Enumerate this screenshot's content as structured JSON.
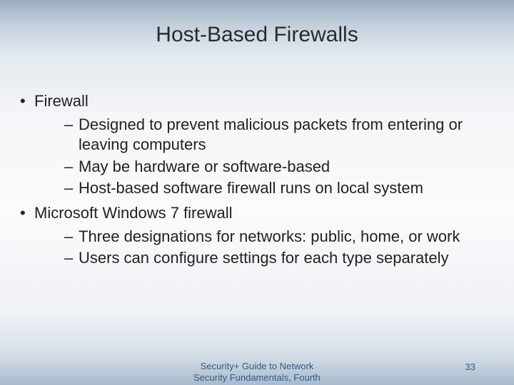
{
  "title": "Host-Based Firewalls",
  "bullets": [
    {
      "text": "Firewall",
      "children": [
        "Designed to prevent malicious packets from entering or leaving computers",
        "May be hardware or software-based",
        "Host-based software firewall runs on local system"
      ]
    },
    {
      "text": "Microsoft Windows 7 firewall",
      "children": [
        "Three designations for networks: public, home, or work",
        "Users can configure settings for each type separately"
      ]
    }
  ],
  "footer": {
    "source_line1": "Security+ Guide to Network",
    "source_line2": "Security Fundamentals, Fourth",
    "page": "33"
  }
}
